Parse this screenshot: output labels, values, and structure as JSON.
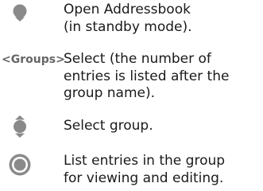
{
  "colors": {
    "icon_gray": "#8a8a8a",
    "icon_light": "#cfcfcf",
    "key_text": "#666666",
    "text": "#1a1a1a"
  },
  "steps": [
    {
      "key_type": "icon",
      "key_icon": "navigation-key-down-icon",
      "description": "Open Addressbook\n(in standby mode)."
    },
    {
      "key_type": "text",
      "key_label": "<Groups>",
      "description": "Select (the number of\nentries is listed after the\ngroup name)."
    },
    {
      "key_type": "icon",
      "key_icon": "navigation-key-up-down-icon",
      "description": "Select group."
    },
    {
      "key_type": "icon",
      "key_icon": "center-select-key-icon",
      "description": "List entries in the group\nfor viewing and editing."
    }
  ]
}
